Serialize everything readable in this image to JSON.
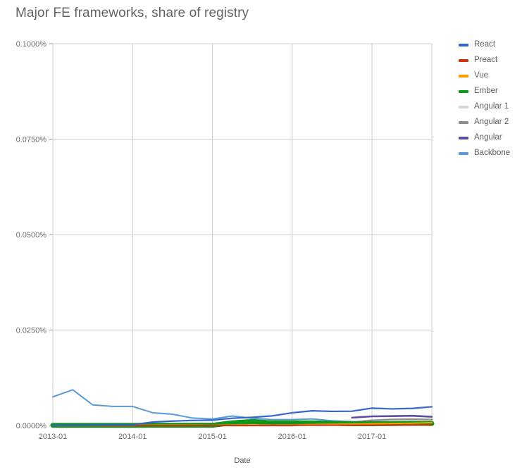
{
  "chart_data": {
    "type": "line",
    "title": "Major FE frameworks, share of registry",
    "xlabel": "Date",
    "ylabel": "",
    "grid": true,
    "legend_position": "right",
    "ylim": [
      0,
      0.001
    ],
    "y_tick_labels": [
      "0.1000%",
      "0.0750%",
      "0.0500%",
      "0.0250%",
      "0.0000%"
    ],
    "y_tick_values": [
      0.001,
      0.00075,
      0.0005,
      0.00025,
      0
    ],
    "x_tick_labels": [
      "2013-01",
      "2014-01",
      "2015-01",
      "2016-01",
      "2017-01"
    ],
    "x_tick_values": [
      "2013-01",
      "2014-01",
      "2015-01",
      "2016-01",
      "2017-01"
    ],
    "x": [
      "2013-01",
      "2013-04",
      "2013-07",
      "2013-10",
      "2014-01",
      "2014-04",
      "2014-07",
      "2014-10",
      "2015-01",
      "2015-04",
      "2015-07",
      "2015-10",
      "2016-01",
      "2016-04",
      "2016-07",
      "2016-10",
      "2017-01",
      "2017-04",
      "2017-07",
      "2017-10"
    ],
    "series": [
      {
        "name": "React",
        "color": "#3366cc",
        "width": 2.2,
        "values": [
          5e-07,
          8e-07,
          1.2e-06,
          2e-06,
          2.2e-06,
          9e-06,
          1.15e-05,
          1.33e-05,
          1.4e-05,
          1.9e-05,
          2.15e-05,
          2.52e-05,
          3.33e-05,
          3.85e-05,
          3.7e-05,
          3.75e-05,
          4.55e-05,
          4.35e-05,
          4.48e-05,
          4.9e-05
        ]
      },
      {
        "name": "Preact",
        "color": "#cc3311",
        "width": 2.0,
        "values": [
          0,
          0,
          0,
          0,
          0,
          0,
          0,
          0,
          0.0,
          2e-07,
          3e-07,
          4e-07,
          5e-07,
          6e-07,
          7e-07,
          8e-07,
          9e-07,
          1e-06,
          1.1e-06,
          1.2e-06
        ]
      },
      {
        "name": "Vue",
        "color": "#ff9900",
        "width": 2.0,
        "values": [
          0,
          0,
          0,
          0,
          2e-07,
          8e-07,
          1e-06,
          6e-07,
          3e-07,
          1.4e-06,
          1.6e-06,
          1.2e-06,
          1.5e-06,
          2.6e-06,
          3.3e-06,
          4e-06,
          4.6e-06,
          5.2e-06,
          6e-06,
          7.5e-06
        ]
      },
      {
        "name": "Ember",
        "color": "#109618",
        "width": 7.0,
        "values": [
          4e-07,
          4e-07,
          4e-07,
          4e-07,
          5e-07,
          6e-07,
          6e-07,
          6e-07,
          6e-07,
          7e-06,
          1.05e-05,
          6.8e-06,
          7e-06,
          7e-06,
          5.8e-06,
          4.5e-06,
          4.6e-06,
          5e-06,
          5.8e-06,
          5.2e-06
        ]
      },
      {
        "name": "Angular 1",
        "color": "#d5d5d5",
        "width": 2.4,
        "values": [
          0,
          0,
          0,
          0,
          0,
          0,
          0,
          0,
          6e-07,
          1.05e-05,
          1.52e-05,
          8.5e-06,
          8.3e-06,
          1e-05,
          1.03e-05,
          9.3e-06,
          8.8e-06,
          8.8e-06,
          9.2e-06,
          7.5e-06
        ]
      },
      {
        "name": "Angular 2",
        "color": "#8c8c8c",
        "width": 2.4,
        "values": [
          0,
          0,
          0,
          0,
          0,
          0,
          0,
          0,
          0,
          0,
          0,
          0,
          0,
          3.5e-06,
          6.8e-06,
          9e-06,
          1.35e-05,
          1.58e-05,
          1.65e-05,
          1.55e-05
        ]
      },
      {
        "name": "Angular",
        "color": "#5b4fa0",
        "width": 2.6,
        "values": [
          null,
          null,
          null,
          null,
          null,
          null,
          null,
          null,
          null,
          null,
          null,
          null,
          null,
          null,
          null,
          2.05e-05,
          2.4e-05,
          2.45e-05,
          2.55e-05,
          2.3e-05
        ]
      },
      {
        "name": "Backbone",
        "color": "#5b9bd5",
        "width": 2.0,
        "values": [
          7.5e-05,
          9.35e-05,
          5.4e-05,
          5e-05,
          5e-05,
          3.35e-05,
          2.95e-05,
          1.95e-05,
          1.7e-05,
          2.5e-05,
          1.9e-05,
          1.55e-05,
          1.55e-05,
          1.72e-05,
          1.25e-05,
          1.05e-05,
          8e-06,
          6.2e-06,
          5.2e-06,
          5e-06
        ]
      }
    ]
  },
  "legend": {
    "items": [
      {
        "label": "React",
        "color": "#3366cc"
      },
      {
        "label": "Preact",
        "color": "#cc3311"
      },
      {
        "label": "Vue",
        "color": "#ff9900"
      },
      {
        "label": "Ember",
        "color": "#109618"
      },
      {
        "label": "Angular 1",
        "color": "#d5d5d5"
      },
      {
        "label": "Angular 2",
        "color": "#8c8c8c"
      },
      {
        "label": "Angular",
        "color": "#5b4fa0"
      },
      {
        "label": "Backbone",
        "color": "#5b9bd5"
      }
    ]
  }
}
